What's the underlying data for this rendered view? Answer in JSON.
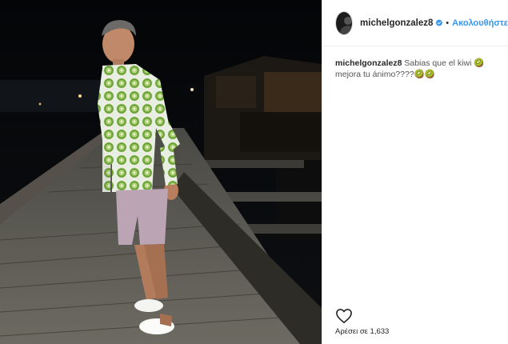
{
  "header": {
    "username": "michelgonzalez8",
    "verified_icon": "verified-badge-icon",
    "separator": "•",
    "follow_label": "Ακολουθήστε"
  },
  "caption": {
    "username": "michelgonzalez8",
    "text": "Sabias que el kiwi 🥝 mejora tu ánimo????🥝🥝"
  },
  "actions": {
    "like_icon": "heart-icon",
    "likes_text": "Αρέσει σε 1,633"
  },
  "colors": {
    "link": "#3897f0",
    "text": "#262626",
    "photo_bg": "#07080b"
  }
}
